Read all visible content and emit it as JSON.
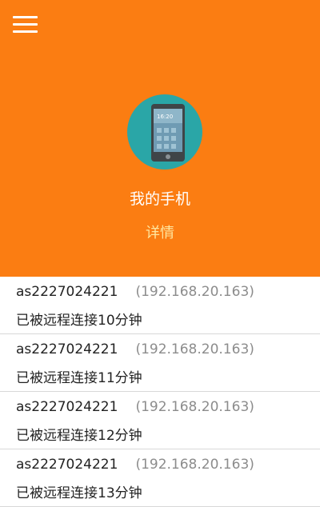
{
  "header": {
    "device_title": "我的手机",
    "details_label": "详情",
    "bg_color": "#fb7d12"
  },
  "icons": {
    "menu": "hamburger-menu-icon",
    "device": "tablet-phone-icon"
  },
  "phone_screen_time": "16:20",
  "connections": [
    {
      "name": "as2227024221",
      "ip": "(192.168.20.163)",
      "status": "已被远程连接10分钟"
    },
    {
      "name": "as2227024221",
      "ip": "(192.168.20.163)",
      "status": "已被远程连接11分钟"
    },
    {
      "name": "as2227024221",
      "ip": "(192.168.20.163)",
      "status": "已被远程连接12分钟"
    },
    {
      "name": "as2227024221",
      "ip": "(192.168.20.163)",
      "status": "已被远程连接13分钟"
    }
  ]
}
